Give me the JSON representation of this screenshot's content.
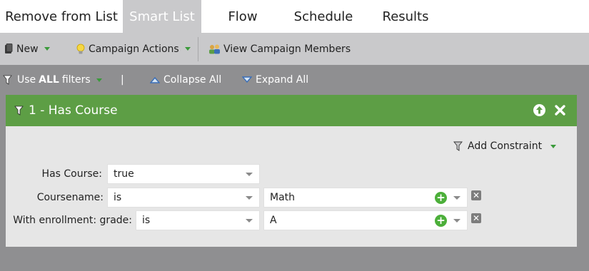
{
  "tabs": [
    {
      "label": "Remove from List"
    },
    {
      "label": "Smart List"
    },
    {
      "label": "Flow"
    },
    {
      "label": "Schedule"
    },
    {
      "label": "Results"
    }
  ],
  "toolbar": {
    "new_label": "New",
    "campaign_actions_label": "Campaign Actions",
    "view_members_label": "View Campaign Members"
  },
  "filterbar": {
    "use_prefix": "Use",
    "use_emphasis": "ALL",
    "use_suffix": "filters",
    "divider": "|",
    "collapse_label": "Collapse All",
    "expand_label": "Expand All"
  },
  "filter": {
    "title": "1 - Has Course",
    "add_constraint_label": "Add Constraint",
    "rows": [
      {
        "label": "Has Course:",
        "operator": "true"
      },
      {
        "label": "Coursename:",
        "operator": "is",
        "value": "Math"
      },
      {
        "label": "With enrollment: grade:",
        "operator": "is",
        "value": "A"
      }
    ]
  },
  "colors": {
    "header_green": "#5d9e45",
    "active_tab": "#c9c9cb",
    "background": "#8f8f91",
    "add_green": "#4caf3a"
  }
}
